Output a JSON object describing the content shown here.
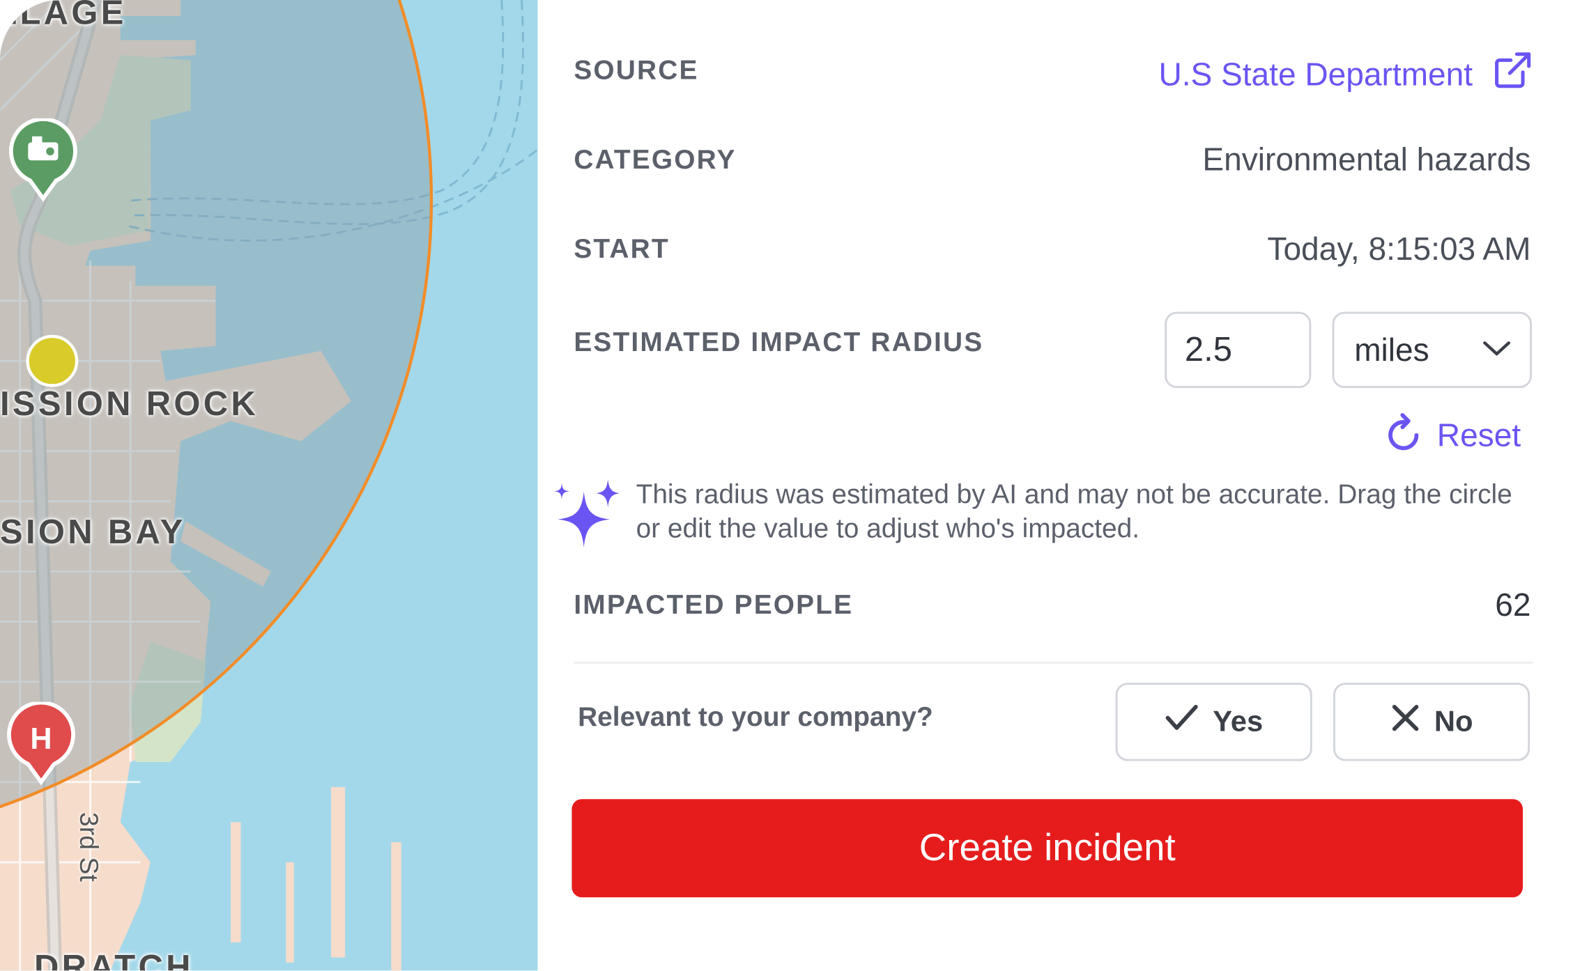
{
  "map": {
    "labels": {
      "village": "LLAGE",
      "mission_rock": "ISSION ROCK",
      "mission_bay": "SION BAY",
      "street": "3rd St",
      "bottom": "DRATCH"
    },
    "hospital_letter": "H",
    "colors": {
      "water": "#a3d8ea",
      "land": "#f6dccb",
      "park": "#d4e4c8",
      "radius_fill": "#a6bdc6",
      "radius_stroke": "#f28c28",
      "park_pin": "#5a9c63",
      "hospital_pin": "#e04b4b",
      "marker_dot": "#d8cb2a"
    }
  },
  "details": {
    "source": {
      "label": "SOURCE",
      "value": "U.S State Department",
      "icon": "external-link-icon"
    },
    "category": {
      "label": "CATEGORY",
      "value": "Environmental hazards"
    },
    "start": {
      "label": "START",
      "value": "Today, 8:15:03 AM"
    },
    "radius": {
      "label": "ESTIMATED IMPACT RADIUS",
      "value": "2.5",
      "unit": "miles",
      "unit_icon": "chevron-down-icon",
      "reset_label": "Reset",
      "reset_icon": "refresh-icon"
    },
    "ai_note": {
      "icon": "sparkles-icon",
      "text": "This radius was estimated by AI and may not be accurate. Drag the circle or edit the value to adjust who's impacted."
    },
    "impacted": {
      "label": "IMPACTED PEOPLE",
      "value": "62"
    }
  },
  "relevance": {
    "question": "Relevant to your company?",
    "yes_label": "Yes",
    "no_label": "No"
  },
  "actions": {
    "create_label": "Create incident"
  },
  "colors": {
    "accent": "#6a55f2",
    "danger": "#e61c1c",
    "label": "#5b606b",
    "border": "#d2d5da"
  }
}
